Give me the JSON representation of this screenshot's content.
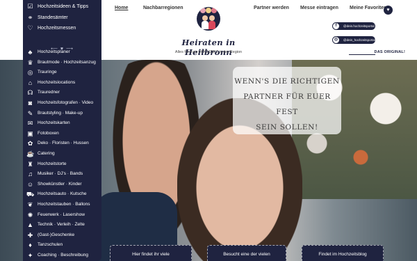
{
  "nav": {
    "home": "Home",
    "nachbarregionen": "Nachbarregionen",
    "partner": "Partner werden",
    "messe": "Messe eintragen",
    "favoriten": "Meine Favoriten:"
  },
  "logo": {
    "title": "Heiraten in Heilbronn",
    "subtitle": "Alles für eure HOCHZEIT in der Region"
  },
  "social": {
    "facebook": "@dein.hochzeitsportal",
    "instagram": "@dein_hochzeitsportal"
  },
  "original_label": "DAS ORIGINAL!",
  "sidebar": {
    "top_links": [
      {
        "label": "Hochzeitsideen & Tipps",
        "icon": "checklist-icon"
      },
      {
        "label": "Standesämter",
        "icon": "rings-icon"
      },
      {
        "label": "Hochzeitsmessen",
        "icon": "chat-heart-icon"
      }
    ],
    "divider": "⟵ ♥ ⟶",
    "categories": [
      {
        "label": "Hochzeitsplaner",
        "icon": "planner-icon"
      },
      {
        "label": "Brautmode · Hochzeitsanzug",
        "icon": "dress-icon"
      },
      {
        "label": "Trauringe",
        "icon": "ring-icon"
      },
      {
        "label": "Hochzeitslocations",
        "icon": "location-icon"
      },
      {
        "label": "Trauredner",
        "icon": "speaker-icon"
      },
      {
        "label": "Hochzeitsfotografen · Video",
        "icon": "camera-icon"
      },
      {
        "label": "Brautstyling · Make-up",
        "icon": "makeup-icon"
      },
      {
        "label": "Hochzeitskarten",
        "icon": "card-icon"
      },
      {
        "label": "Fotoboxen",
        "icon": "photobox-icon"
      },
      {
        "label": "Deko · Floristen · Hussen",
        "icon": "flower-icon"
      },
      {
        "label": "Catering",
        "icon": "catering-icon"
      },
      {
        "label": "Hochzeitstorte",
        "icon": "cake-icon"
      },
      {
        "label": "Musiker · DJ's · Bands",
        "icon": "music-icon"
      },
      {
        "label": "Showkünstler · Kinder",
        "icon": "show-icon"
      },
      {
        "label": "Hochzeitsauto · Kutsche",
        "icon": "car-icon"
      },
      {
        "label": "Hochzeitstauben · Ballons",
        "icon": "dove-icon"
      },
      {
        "label": "Feuerwerk · Lasershow",
        "icon": "fireworks-icon"
      },
      {
        "label": "Technik · Verleih · Zelte",
        "icon": "tent-icon"
      },
      {
        "label": "(Gast-)Geschenke",
        "icon": "gift-icon"
      },
      {
        "label": "Tanzschulen",
        "icon": "dance-icon"
      },
      {
        "label": "Coaching · Beschreibung",
        "icon": "coaching-icon"
      }
    ]
  },
  "hero": {
    "quote": [
      "WENN'S DIE RICHTIGEN",
      "PARTNER FÜR EUER FEST",
      "SEIN SOLLEN!"
    ]
  },
  "cta": {
    "left": "Hier findet ihr viele",
    "middle": "Besucht eine der vielen",
    "right": "Findet im Hochzeitsblog"
  },
  "colors": {
    "navy": "#1f2340",
    "white": "#ffffff"
  }
}
